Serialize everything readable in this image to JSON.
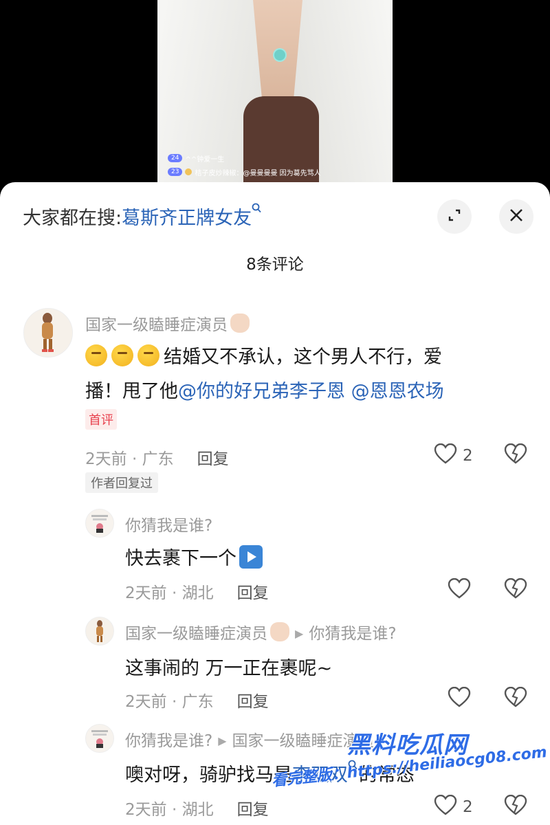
{
  "live_chat": [
    {
      "level": "24",
      "text": "^^钟爱一生"
    },
    {
      "level": "23",
      "text": "桔子皮炒辣椒：@曼曼曼曼 因为葛先骂人"
    }
  ],
  "search_bar": {
    "prefix": "大家都在搜:",
    "term": "葛斯齐正牌女友",
    "term_icon": "search-icon"
  },
  "header": {
    "comment_count": "8条评论",
    "expand_icon": "expand-icon",
    "close_icon": "close-icon"
  },
  "comments": [
    {
      "user": "国家一级瞌睡症演员",
      "text_line1": "结婚又不承认，这个男人不行，爱",
      "text_line2_prefix": "播！甩了他",
      "mention1": "@你的好兄弟李子恩",
      "mention2": "@恩恩农场",
      "badge": "首评",
      "time_location": "2天前 · 广东",
      "reply": "回复",
      "likes": "2",
      "author_tag": "作者回复过"
    },
    {
      "user": "你猜我是谁?",
      "text": "快去裹下一个",
      "time_location": "2天前 · 湖北",
      "reply": "回复"
    },
    {
      "user": "国家一级瞌睡症演员",
      "reply_to": "你猜我是谁?",
      "text": "这事闹的  万一正在裹呢~",
      "time_location": "2天前 · 广东",
      "reply": "回复"
    },
    {
      "user": "你猜我是谁?",
      "reply_to": "国家一级瞌睡症演员",
      "text_prefix": "噢对呀，骑驴找马是",
      "mention": "李双双",
      "text_suffix": "的常态",
      "time_location": "2天前 · 湖北",
      "reply": "回复",
      "likes": "2"
    }
  ],
  "watermark": {
    "brand": "黑料吃瓜网",
    "url": "看完整版：https://heiliaocg08.com"
  },
  "colors": {
    "mention_blue": "#2b64b7",
    "badge_red": "#e8424f",
    "meta_gray": "#9a9a9a"
  }
}
